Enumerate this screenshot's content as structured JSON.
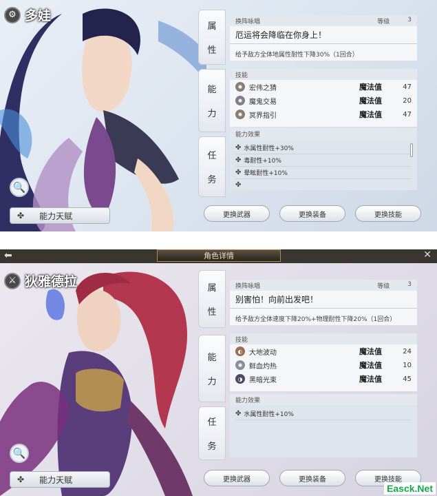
{
  "panel1": {
    "name": "多娃",
    "talent_label": "能力天赋",
    "tabs": [
      "属",
      "性",
      "能",
      "力",
      "任",
      "务"
    ],
    "attr": {
      "header": "换阵咏唱",
      "level_label": "等级",
      "level": "3",
      "quote": "厄运将会降临在你身上！",
      "desc": "给予敌方全体地属性耐性下降30%（1回合）"
    },
    "skills_header": "技能",
    "skills": [
      {
        "name": "宏伟之猜",
        "type": "魔法值",
        "value": "47"
      },
      {
        "name": "魔鬼交易",
        "type": "魔法值",
        "value": "20"
      },
      {
        "name": "冥界指引",
        "type": "魔法值",
        "value": "47"
      }
    ],
    "effects_header": "能力效果",
    "effects": [
      "水属性耐性+30%",
      "毒耐性+10%",
      "晕眩耐性+10%"
    ],
    "buttons": [
      "更换武器",
      "更换装备",
      "更换技能"
    ]
  },
  "panel2": {
    "title": "角色详情",
    "name": "狄雅德拉",
    "talent_label": "能力天赋",
    "tabs": [
      "属",
      "性",
      "能",
      "力",
      "任",
      "务"
    ],
    "attr": {
      "header": "换阵咏唱",
      "level_label": "等级",
      "level": "3",
      "quote": "别害怕！向前出发吧！",
      "desc": "给予敌方全体速度下降20%+物理耐性下降20%（1回合）"
    },
    "skills_header": "技能",
    "skills": [
      {
        "name": "大地波动",
        "type": "魔法值",
        "value": "24"
      },
      {
        "name": "鲜血灼热",
        "type": "魔法值",
        "value": "10"
      },
      {
        "name": "黑暗光束",
        "type": "魔法值",
        "value": "45"
      }
    ],
    "effects_header": "能力效果",
    "effects": [
      "水属性耐性+10%"
    ],
    "buttons": [
      "更换武器",
      "更换装备",
      "更换技能"
    ]
  },
  "watermark": "Easck.Net"
}
